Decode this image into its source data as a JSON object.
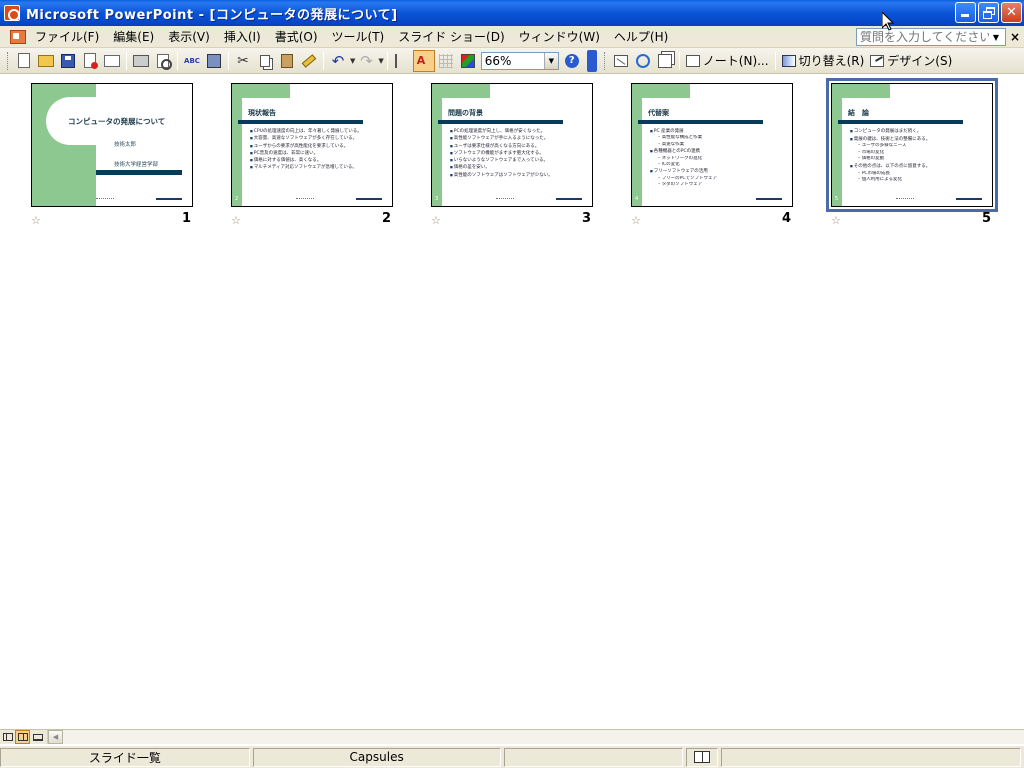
{
  "window": {
    "title": "Microsoft PowerPoint - [コンピュータの発展について]"
  },
  "menu": {
    "items": [
      {
        "label": "ファイル(F)"
      },
      {
        "label": "編集(E)"
      },
      {
        "label": "表示(V)"
      },
      {
        "label": "挿入(I)"
      },
      {
        "label": "書式(O)"
      },
      {
        "label": "ツール(T)"
      },
      {
        "label": "スライド ショー(D)"
      },
      {
        "label": "ウィンドウ(W)"
      },
      {
        "label": "ヘルプ(H)"
      }
    ],
    "help_placeholder": "質問を入力してください",
    "close_glyph": "×"
  },
  "toolbar": {
    "spelling_label": "ABC",
    "zoom_value": "66%",
    "help_glyph": "?",
    "notes_label": "ノート(N)...",
    "transition_label": "切り替え(R)",
    "design_label": "デザイン(S)"
  },
  "slides": [
    {
      "number": "1",
      "title": "コンピュータの発展について",
      "author": "技術太郎",
      "affiliation": "技術大学経営学部"
    },
    {
      "number": "2",
      "title": "現状報告",
      "bullets": [
        "CPUの処理速度の向上は、年々著しく発展している。",
        "大容量、高速なソフトウェアが多く存在している。",
        "ユーザからの要求が高性能化を要求している。",
        "PC普及の速度は、非常に速い。",
        "価格に対する価値は、高くなる。",
        "マルチメディア対応ソフトウェアが急増している。"
      ]
    },
    {
      "number": "3",
      "title": "問題の背景",
      "bullets": [
        "PCの処理速度が向上し、価格が安くなった。",
        "高性能ソフトウェアが手に入るようになった。",
        "ユーザは要求仕様が高くなる方向にある。",
        "ソフトウェアの機能がますます肥大化する。",
        "いらないようなソフトウェアまで入っている。",
        "価格の差を安い。",
        "高性能のソフトウェアはソフトウェアが少ない。"
      ]
    },
    {
      "number": "4",
      "title": "代替案",
      "items": [
        {
          "type": "b",
          "text": "PC 産業の発展"
        },
        {
          "type": "sub",
          "text": "高性能な構成と作業"
        },
        {
          "type": "sub",
          "text": "高速な作業"
        },
        {
          "type": "b",
          "text": "各種機器とのPCの連携"
        },
        {
          "type": "sub",
          "text": "ネットワークの進化"
        },
        {
          "type": "sub",
          "text": "ICの変化"
        },
        {
          "type": "b",
          "text": "フリーソフトウェアの活用"
        },
        {
          "type": "sub",
          "text": "フリーのPCでソフトウェア"
        },
        {
          "type": "sub",
          "text": "タダのソフトウェア"
        }
      ]
    },
    {
      "number": "5",
      "title": "結　論",
      "items": [
        {
          "type": "b",
          "text": "コンピュータの発展はまだ続く。"
        },
        {
          "type": "b",
          "text": "発展の鍵は、技術と法の整備にある。"
        },
        {
          "type": "sub",
          "text": "ユーザの多様なニーズ"
        },
        {
          "type": "sub",
          "text": "市場の変化"
        },
        {
          "type": "sub",
          "text": "価格の変動"
        },
        {
          "type": "b",
          "text": "その他の点は、以下の点に留意する。"
        },
        {
          "type": "sub",
          "text": "PC市場の成長"
        },
        {
          "type": "sub",
          "text": "個人利用による変化"
        }
      ]
    }
  ],
  "selected_slide": "5",
  "status": {
    "view": "スライド一覧",
    "design": "Capsules"
  },
  "colors": {
    "title_bar": "#0a55d8",
    "slide_green": "#8cc890",
    "slide_navy": "#0a3a5a",
    "selection": "#4a6aa8"
  }
}
